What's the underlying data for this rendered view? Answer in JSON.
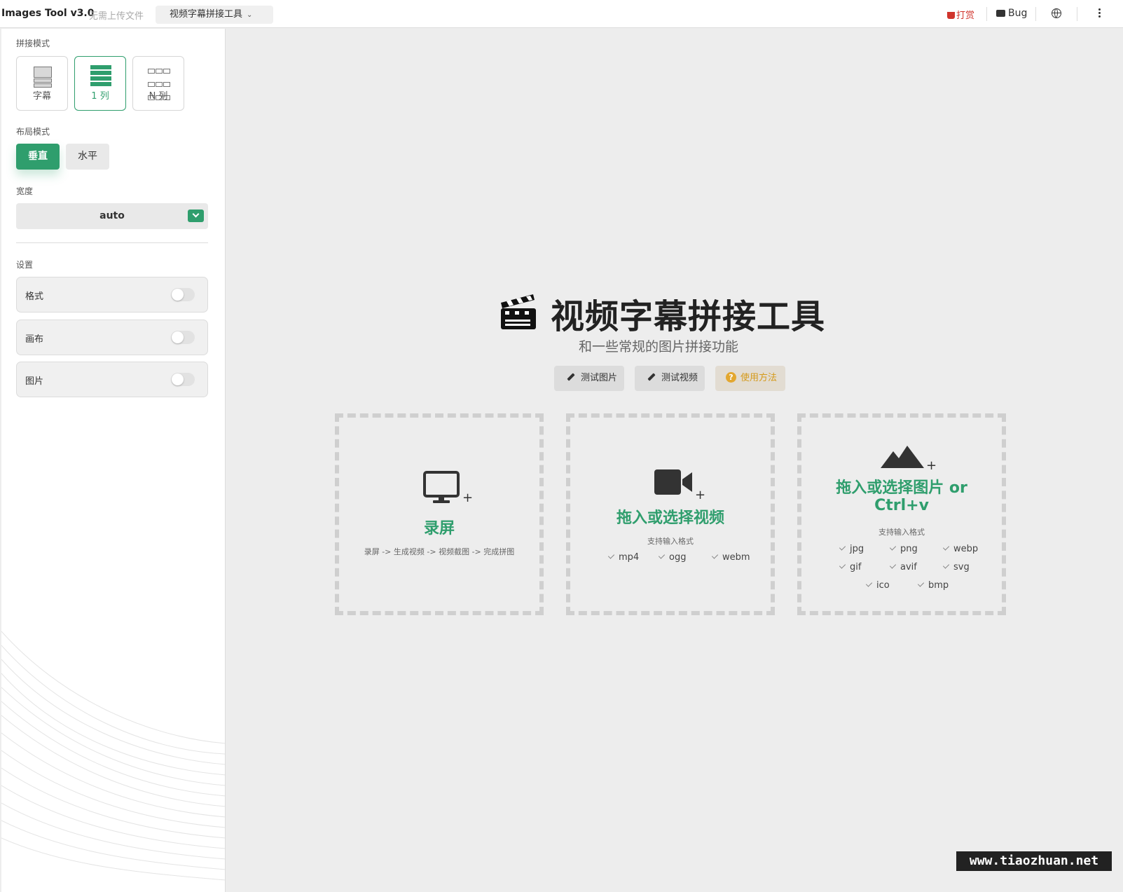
{
  "header": {
    "app_title": "Images Tool v3.0",
    "app_subtitle": "无需上传文件",
    "tool_selector": "视频字幕拼接工具",
    "donate_label": "打赏",
    "bug_label": "Bug",
    "language_icon": "globe-icon",
    "more_icon": "kebab-menu-icon"
  },
  "sidebar": {
    "stitch_mode_label": "拼接模式",
    "stitch_modes": [
      {
        "label": "字幕",
        "active": false
      },
      {
        "label": "1 列",
        "active": true
      },
      {
        "label": "N 列",
        "active": false
      }
    ],
    "layout_mode_label": "布局模式",
    "layout_modes": [
      {
        "label": "垂直",
        "active": true
      },
      {
        "label": "水平",
        "active": false
      }
    ],
    "width_label": "宽度",
    "width_value": "auto",
    "settings_label": "设置",
    "settings": [
      {
        "label": "格式",
        "enabled": false
      },
      {
        "label": "画布",
        "enabled": false
      },
      {
        "label": "图片",
        "enabled": false
      }
    ]
  },
  "main": {
    "hero_title": "视频字幕拼接工具",
    "hero_subtitle": "和一些常规的图片拼接功能",
    "actions": [
      {
        "label": "测试图片",
        "icon": "pen-icon"
      },
      {
        "label": "测试视频",
        "icon": "pen-icon"
      },
      {
        "label": "使用方法",
        "icon": "help-icon"
      }
    ],
    "drop_zones": {
      "record": {
        "title": "录屏",
        "description": "录屏 -> 生成视频 -> 视频截图 -> 完成拼图"
      },
      "video": {
        "title": "拖入或选择视频",
        "formats_label": "支持输入格式",
        "formats": [
          "mp4",
          "ogg",
          "webm"
        ]
      },
      "image": {
        "title_line1": "拖入或选择图片 or",
        "title_line2": "Ctrl+v",
        "formats_label": "支持输入格式",
        "formats": [
          "jpg",
          "png",
          "webp",
          "gif",
          "avif",
          "svg",
          "ico",
          "bmp"
        ]
      }
    }
  },
  "watermark": "www.tiaozhuan.net",
  "colors": {
    "accent": "#2f9e6d",
    "donate": "#d0342c",
    "help": "#d59a1b",
    "background": "#ededed"
  }
}
